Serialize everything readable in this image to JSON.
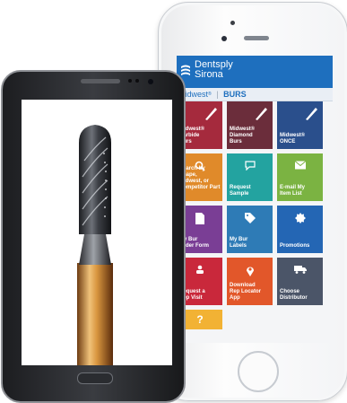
{
  "iphone_app": {
    "brand_line1": "Dentsply",
    "brand_line2": "Sirona",
    "subheader_left": "Midwest",
    "subheader_sep": "|",
    "subheader_right": "BURS",
    "tiles": [
      {
        "label": "Midwest®\nCarbide\nBurs",
        "color": "#a52a3d",
        "icon": "bur-icon"
      },
      {
        "label": "Midwest®\nDiamond\nBurs",
        "color": "#6b2d3b",
        "icon": "bur-icon"
      },
      {
        "label": "Midwest® ONCE",
        "color": "#2a4f8c",
        "icon": "bur-icon"
      },
      {
        "label": "Search by Shape,\nMidwest, or\nCompetitor Part #",
        "color": "#e08a2a",
        "icon": "search-icon"
      },
      {
        "label": "Request\nSample",
        "color": "#23a3a0",
        "icon": "chat-icon"
      },
      {
        "label": "E-mail My\nItem List",
        "color": "#7bb342",
        "icon": "envelope-icon"
      },
      {
        "label": "My Bur\nOrder Form",
        "color": "#7a3e95",
        "icon": "document-icon"
      },
      {
        "label": "My Bur\nLabels",
        "color": "#2e7bb6",
        "icon": "tag-icon"
      },
      {
        "label": "Promotions",
        "color": "#2466b4",
        "icon": "badge-icon"
      },
      {
        "label": "Request a\nRep Visit",
        "color": "#c9283b",
        "icon": "person-icon"
      },
      {
        "label": "Download\nRep Locator\nApp",
        "color": "#e2572a",
        "icon": "pin-icon"
      },
      {
        "label": "Choose\nDistributor",
        "color": "#4b5568",
        "icon": "truck-icon"
      },
      {
        "label": "",
        "color": "#f2b234",
        "icon": "help-icon"
      }
    ]
  },
  "colors": {
    "header_blue": "#1e6fbe",
    "bur_gold": "#c9893a",
    "bur_head": "#3a3d43"
  }
}
